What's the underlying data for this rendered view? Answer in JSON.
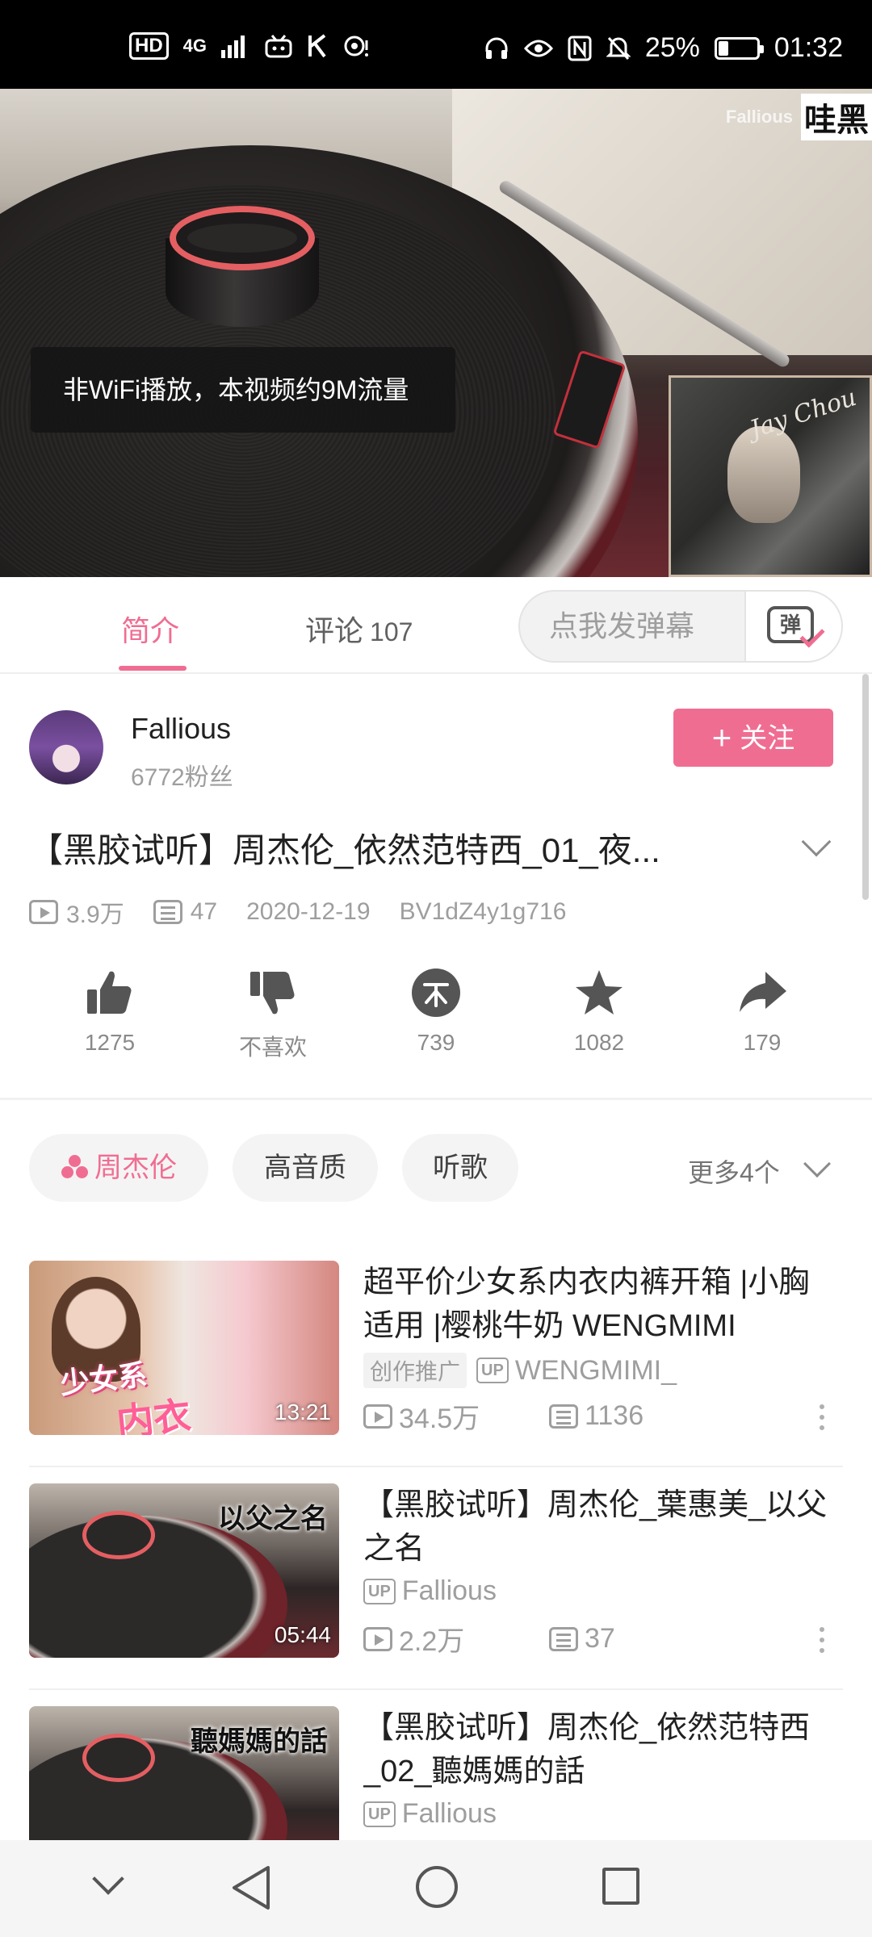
{
  "status_bar": {
    "left_icons": [
      "HD",
      "4G",
      "signal-icon",
      "bilibili-icon",
      "k-icon",
      "hotspot-icon"
    ],
    "right_icons": [
      "headphone-icon",
      "eye-icon",
      "nfc-icon",
      "mute-icon"
    ],
    "battery": "25%",
    "battery_level": 0.25,
    "time": "01:32"
  },
  "video": {
    "watermark_logo": "Fallious",
    "watermark_text": "哇黑",
    "toast": "非WiFi播放，本视频约9M流量",
    "album_text": "Jay Chou"
  },
  "tabs": {
    "intro": "简介",
    "comments": "评论",
    "comments_count": "107",
    "danmaku_placeholder": "点我发弹幕",
    "danmaku_button": "弹"
  },
  "uploader": {
    "name": "Fallious",
    "fans": "6772粉丝",
    "follow_label": "关注"
  },
  "video_info": {
    "title": "【黑胶试听】周杰伦_依然范特西_01_夜...",
    "views": "3.9万",
    "danmaku": "47",
    "date": "2020-12-19",
    "bvid": "BV1dZ4y1g716"
  },
  "actions": {
    "like": "1275",
    "dislike": "不喜欢",
    "coin": "739",
    "favorite": "1082",
    "share": "179"
  },
  "tags": {
    "items": [
      "周杰伦",
      "高音质",
      "听歌"
    ],
    "more": "更多4个"
  },
  "related": [
    {
      "title": "超平价少女系内衣内裤开箱 |小胸适用 |樱桃牛奶 WENGMIMI",
      "promo": "创作推广",
      "up_badge": "UP",
      "author": "WENGMIMI_",
      "views": "34.5万",
      "danmaku": "1136",
      "duration": "13:21",
      "thumb_text_1": "少女系",
      "thumb_text_2": "内衣"
    },
    {
      "title": "【黑胶试听】周杰伦_葉惠美_以父之名",
      "up_badge": "UP",
      "author": "Fallious",
      "views": "2.2万",
      "danmaku": "37",
      "duration": "05:44",
      "thumb_text": "以父之名"
    },
    {
      "title": "【黑胶试听】周杰伦_依然范特西_02_聽媽媽的話",
      "up_badge": "UP",
      "author": "Fallious",
      "thumb_text": "聽媽媽的話"
    }
  ],
  "colors": {
    "accent": "#f06d92",
    "status_bar_bg": "#000000",
    "nav_bar_bg": "#f5f5f5"
  }
}
